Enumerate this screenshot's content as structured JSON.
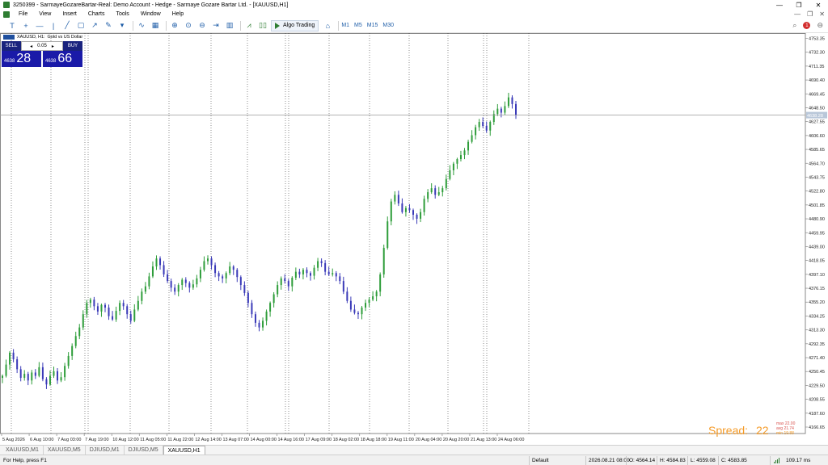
{
  "window": {
    "title": "3250399 - SarmayeGozareBartar-Real: Demo Account - Hedge - Sarmaye Gozare Bartar Ltd. - [XAUUSD,H1]",
    "minimize": "—",
    "maximize": "❐",
    "close": "✕"
  },
  "menu": {
    "items": [
      "File",
      "View",
      "Insert",
      "Charts",
      "Tools",
      "Window",
      "Help"
    ],
    "right": {
      "mdi_minimize": "—",
      "mdi_restore": "❐",
      "mdi_close": "✕"
    }
  },
  "toolbar": {
    "algo_trading_label": "Algo Trading",
    "timeframes": [
      "M1",
      "M5",
      "M15",
      "M30"
    ],
    "notification_count": "1",
    "icons": [
      "cursor-icon",
      "crosshair-icon",
      "hline-icon",
      "vline-icon",
      "trendline-icon",
      "shapes-icon",
      "arrow-icon",
      "pen-icon",
      "dropdown-icon",
      "indicator-icon",
      "grid-icon",
      "zoom-in-icon",
      "zoom-out-icon",
      "auto-scroll-icon",
      "chart-shift-icon",
      "line-chart-icon",
      "candles-icon",
      "algo-icon",
      "market-icon",
      "search-icon",
      "bell-icon",
      "account-icon"
    ]
  },
  "chart_info": {
    "symbol": "XAUUSD, H1:",
    "description": "Gold vs US Dollar"
  },
  "one_click": {
    "sell_label": "SELL",
    "buy_label": "BUY",
    "lot": "0.05",
    "sell_price_small": "4638",
    "sell_price_big": "28",
    "buy_price_small": "4638",
    "buy_price_big": "66"
  },
  "spread": {
    "label": "Spread:",
    "value": "22",
    "max_label": "max",
    "max_value": "22.00",
    "avg_label": "avg",
    "avg_value": "21.74",
    "min_label": "min",
    "min_value": "19.88"
  },
  "tabs": [
    "XAUUSD,M1",
    "XAUUSD,M5",
    "DJIUSD,M1",
    "DJIUSD,M5",
    "XAUUSD,H1"
  ],
  "active_tab": "XAUUSD,H1",
  "status": {
    "help": "For Help, press F1",
    "profile": "Default",
    "time": "2026.08.21 08:00",
    "open": "O: 4564.14",
    "high": "H: 4584.83",
    "low": "L: 4559.08",
    "close": "C: 4583.85",
    "ping": "109.17 ms"
  },
  "chart_data": {
    "type": "candlestick",
    "symbol": "XAUUSD",
    "timeframe": "H1",
    "current_price": "4638.28",
    "ylim": [
      4158.0,
      4762.0
    ],
    "y_tick_labels": [
      "4753.35",
      "4732.30",
      "4711.35",
      "4690.40",
      "4669.45",
      "4648.50",
      "4627.55",
      "4606.60",
      "4585.65",
      "4564.70",
      "4543.75",
      "4522.80",
      "4501.85",
      "4480.90",
      "4459.95",
      "4439.00",
      "4418.05",
      "4397.10",
      "4376.15",
      "4355.20",
      "4334.25",
      "4313.30",
      "4292.35",
      "4271.40",
      "4250.45",
      "4229.50",
      "4208.55",
      "4187.60",
      "4166.65"
    ],
    "x_tick_labels": [
      "5 Aug 2026",
      "6 Aug 10:00",
      "7 Aug 03:00",
      "7 Aug 19:00",
      "10 Aug 12:00",
      "11 Aug 05:00",
      "11 Aug 22:00",
      "12 Aug 14:00",
      "13 Aug 07:00",
      "14 Aug 00:00",
      "14 Aug 16:00",
      "17 Aug 09:00",
      "18 Aug 02:00",
      "18 Aug 18:00",
      "19 Aug 11:00",
      "20 Aug 04:00",
      "20 Aug 20:00",
      "21 Aug 13:00",
      "24 Aug 06:00"
    ],
    "closes": [
      4245,
      4262,
      4280,
      4270,
      4255,
      4242,
      4248,
      4238,
      4250,
      4245,
      4258,
      4240,
      4232,
      4245,
      4252,
      4238,
      4243,
      4260,
      4275,
      4290,
      4305,
      4318,
      4338,
      4355,
      4360,
      4350,
      4342,
      4352,
      4348,
      4335,
      4330,
      4343,
      4355,
      4350,
      4338,
      4328,
      4345,
      4358,
      4372,
      4380,
      4395,
      4410,
      4422,
      4412,
      4398,
      4388,
      4378,
      4372,
      4382,
      4390,
      4385,
      4378,
      4383,
      4392,
      4405,
      4418,
      4422,
      4412,
      4400,
      4395,
      4392,
      4400,
      4410,
      4405,
      4394,
      4382,
      4370,
      4355,
      4338,
      4325,
      4318,
      4328,
      4342,
      4355,
      4368,
      4382,
      4392,
      4388,
      4380,
      4393,
      4402,
      4398,
      4405,
      4400,
      4396,
      4408,
      4418,
      4415,
      4402,
      4398,
      4400,
      4395,
      4388,
      4372,
      4358,
      4345,
      4340,
      4338,
      4348,
      4355,
      4360,
      4365,
      4372,
      4398,
      4438,
      4478,
      4508,
      4518,
      4505,
      4492,
      4498,
      4495,
      4488,
      4482,
      4492,
      4512,
      4522,
      4528,
      4518,
      4522,
      4528,
      4542,
      4555,
      4565,
      4572,
      4578,
      4585,
      4598,
      4608,
      4620,
      4628,
      4622,
      4615,
      4628,
      4640,
      4648,
      4642,
      4652,
      4665,
      4655,
      4638
    ]
  }
}
